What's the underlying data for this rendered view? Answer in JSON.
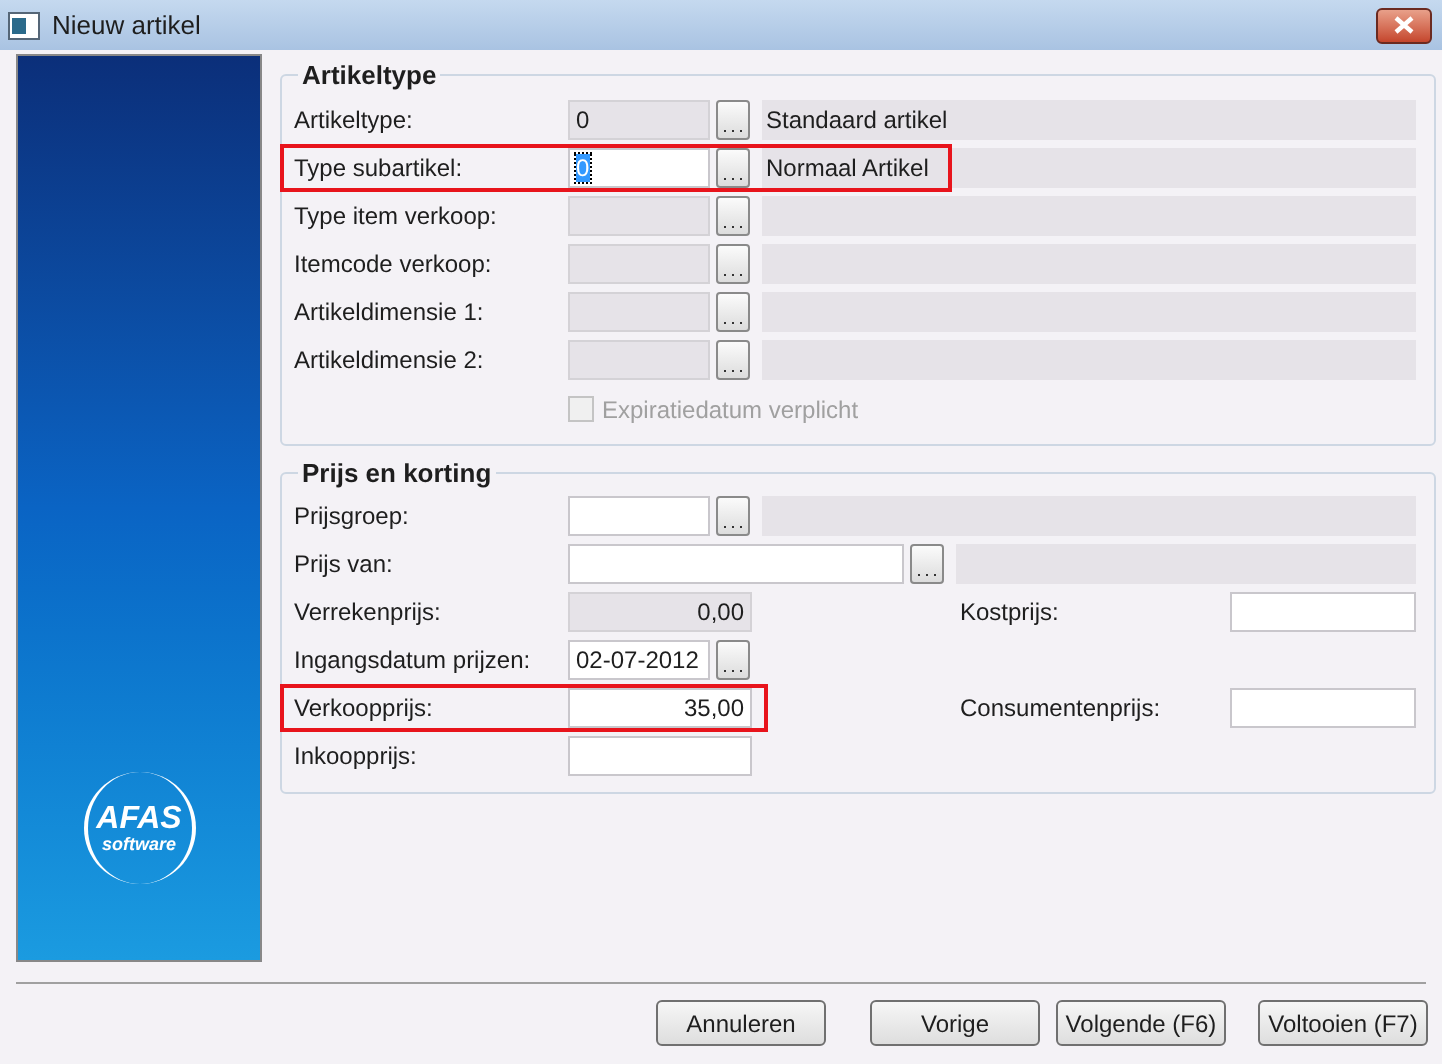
{
  "window": {
    "title": "Nieuw artikel"
  },
  "sidebar": {
    "logo": {
      "name": "AFAS",
      "tagline": "software"
    }
  },
  "artikeltype": {
    "title": "Artikeltype",
    "rows": [
      {
        "label": "Artikeltype:",
        "value": "0",
        "editable": false,
        "highlighted": false,
        "focused": false,
        "description": "Standaard artikel"
      },
      {
        "label": "Type subartikel:",
        "value": "0",
        "editable": true,
        "highlighted": true,
        "focused": true,
        "description": "Normaal Artikel"
      },
      {
        "label": "Type item verkoop:",
        "editable": false,
        "highlighted": false
      },
      {
        "label": "Itemcode verkoop:",
        "editable": false,
        "highlighted": false
      },
      {
        "label": "Artikeldimensie 1:",
        "editable": false,
        "highlighted": false
      },
      {
        "label": "Artikeldimensie 2:",
        "editable": false,
        "highlighted": false
      }
    ],
    "checkbox": {
      "label": "Expiratiedatum verplicht",
      "checked": false,
      "disabled": true
    }
  },
  "prijs": {
    "title": "Prijs en korting",
    "rows": [
      {
        "kind": "lookup",
        "label": "Prijsgroep:",
        "editable": true,
        "highlighted": false
      },
      {
        "kind": "wide_lookup",
        "label": "Prijs van:",
        "editable": true,
        "highlighted": false
      },
      {
        "kind": "amount",
        "label": "Verrekenprijs:",
        "value": "0,00",
        "editable": false,
        "highlighted": false,
        "side": {
          "label": "Kostprijs:"
        }
      },
      {
        "kind": "date",
        "label": "Ingangsdatum prijzen:",
        "value": "02-07-2012",
        "editable": true,
        "highlighted": false
      },
      {
        "kind": "amount",
        "label": "Verkoopprijs:",
        "value": "35,00",
        "editable": true,
        "highlighted": true,
        "side": {
          "label": "Consumentenprijs:"
        }
      },
      {
        "kind": "amount",
        "label": "Inkoopprijs:",
        "editable": true,
        "highlighted": false
      }
    ]
  },
  "buttons": [
    "Annuleren",
    "Vorige",
    "Volgende (F6)",
    "Voltooien (F7)"
  ]
}
